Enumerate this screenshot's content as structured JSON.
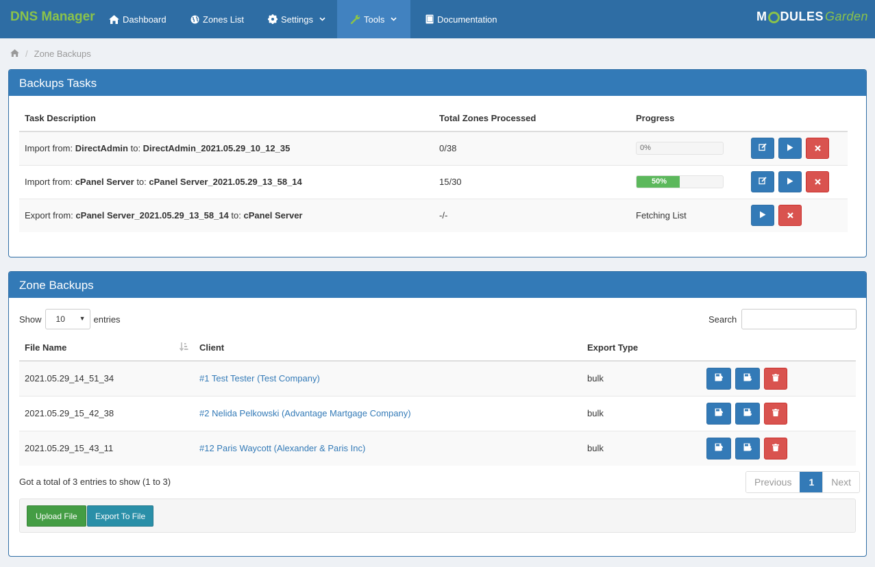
{
  "nav": {
    "brand": "DNS Manager",
    "items": [
      {
        "label": "Dashboard",
        "icon": "home-icon"
      },
      {
        "label": "Zones List",
        "icon": "globe-icon"
      },
      {
        "label": "Settings",
        "icon": "gear-icon"
      },
      {
        "label": "Tools",
        "icon": "wrench-icon"
      },
      {
        "label": "Documentation",
        "icon": "book-icon"
      }
    ],
    "logo": {
      "part1": "M",
      "part2": "DULES",
      "part3": "Garden"
    }
  },
  "breadcrumb": {
    "current": "Zone Backups"
  },
  "tasks_panel": {
    "title": "Backups Tasks",
    "headers": {
      "desc": "Task Description",
      "zones": "Total Zones Processed",
      "progress": "Progress"
    },
    "rows": [
      {
        "prefix": "Import from: ",
        "from": "DirectAdmin",
        "mid": " to: ",
        "to": "DirectAdmin_2021.05.29_10_12_35",
        "zones": "0/38",
        "progress_label": "0%",
        "progress": 0
      },
      {
        "prefix": "Import from: ",
        "from": "cPanel Server",
        "mid": " to: ",
        "to": "cPanel Server_2021.05.29_13_58_14",
        "zones": "15/30",
        "progress_label": "50%",
        "progress": 50
      },
      {
        "prefix": "Export from: ",
        "from": "cPanel Server_2021.05.29_13_58_14",
        "mid": " to: ",
        "to": "cPanel Server",
        "zones": "-/-",
        "status": "Fetching List"
      }
    ]
  },
  "backups_panel": {
    "title": "Zone Backups",
    "show_label": "Show",
    "entries_label": "entries",
    "page_size": "10",
    "search_label": "Search",
    "search_value": "",
    "headers": {
      "file": "File Name",
      "client": "Client",
      "type": "Export Type"
    },
    "rows": [
      {
        "file": "2021.05.29_14_51_34",
        "client": "#1 Test Tester (Test Company)",
        "type": "bulk"
      },
      {
        "file": "2021.05.29_15_42_38",
        "client": "#2 Nelida Pelkowski (Advantage Martgage Company)",
        "type": "bulk"
      },
      {
        "file": "2021.05.29_15_43_11",
        "client": "#12 Paris Waycott (Alexander & Paris Inc)",
        "type": "bulk"
      }
    ],
    "total_text": "Got a total of 3 entries to show (1 to 3)",
    "pager": {
      "prev": "Previous",
      "current": "1",
      "next": "Next"
    },
    "upload_label": "Upload File",
    "export_label": "Export To File"
  }
}
